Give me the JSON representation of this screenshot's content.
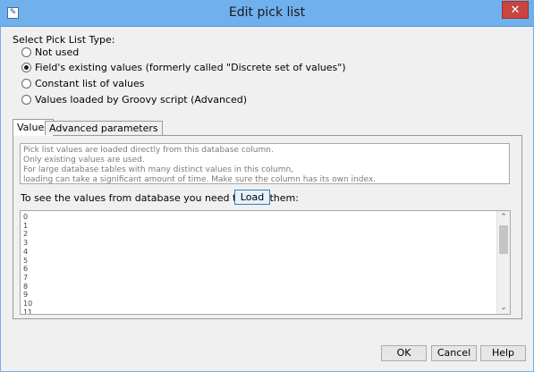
{
  "window": {
    "title": "Edit pick list",
    "icon": "app-window-icon",
    "close_icon": "close-icon",
    "close_glyph": "✕"
  },
  "pick_list_type": {
    "label": "Select Pick List Type:",
    "options": [
      {
        "label": "Not used",
        "checked": false
      },
      {
        "label": "Field's existing values (formerly called \"Discrete set of values\")",
        "checked": true
      },
      {
        "label": "Constant list of values",
        "checked": false
      },
      {
        "label": "Values loaded by Groovy script (Advanced)",
        "checked": false
      }
    ]
  },
  "tabs": [
    {
      "label": "Values",
      "active": true
    },
    {
      "label": "Advanced parameters",
      "active": false
    }
  ],
  "info": {
    "lines": [
      "Pick list values are loaded directly from this database column.",
      "Only existing values are used.",
      "For large database tables with many distinct values in this column,",
      "loading can take a significant amount of time. Make sure the column has its own index."
    ]
  },
  "load": {
    "label": "To see the values from database you need to load them:",
    "button": "Load"
  },
  "values": [
    "0",
    "1",
    "2",
    "3",
    "4",
    "5",
    "6",
    "7",
    "8",
    "9",
    "10",
    "11"
  ],
  "scroll": {
    "up_glyph": "⌃",
    "down_glyph": "⌄"
  },
  "footer": {
    "ok": "OK",
    "cancel": "Cancel",
    "help": "Help"
  }
}
